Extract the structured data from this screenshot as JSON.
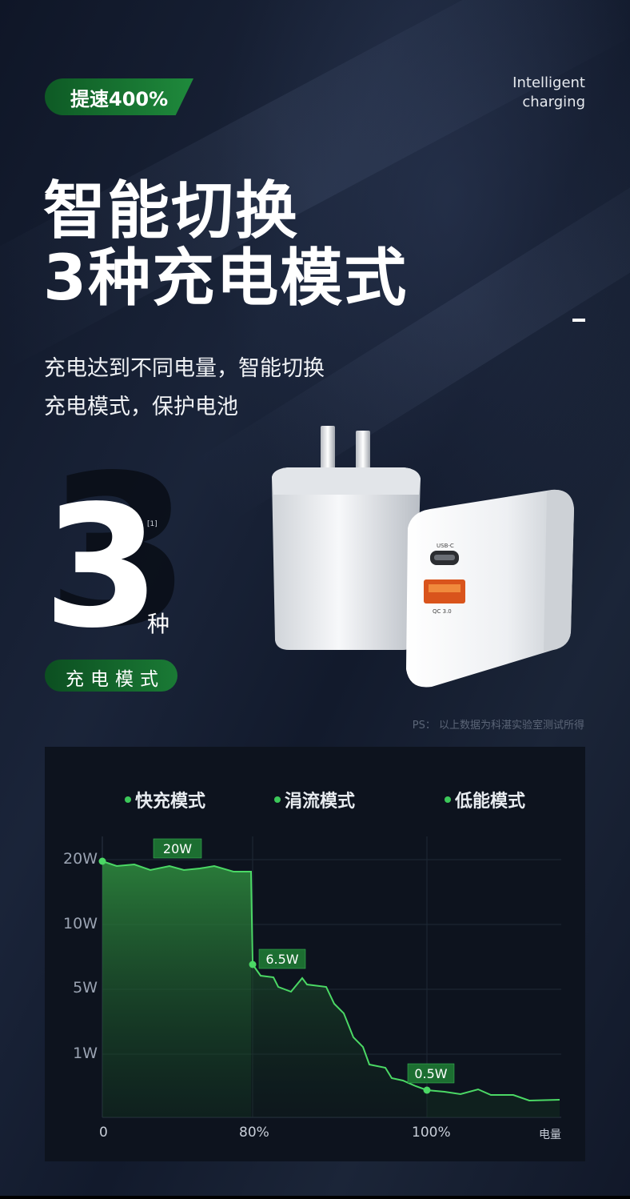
{
  "header": {
    "badge": "提速400%",
    "intelligent_line1": "Intelligent",
    "intelligent_line2": "charging"
  },
  "headline": {
    "line1": "智能切换",
    "line2": "3种充电模式"
  },
  "subtitle": {
    "line1": "充电达到不同电量，智能切换",
    "line2": "充电模式，保护电池"
  },
  "stat": {
    "number": "3",
    "footnote": "[1]",
    "unit": "种",
    "label": "充电模式"
  },
  "product": {
    "port_c_label": "USB-C",
    "port_a_label": "QC 3.0"
  },
  "ps_note": "PS：  以上数据为科湛实验室测试所得",
  "colors": {
    "accent_green": "#1f8a3c",
    "line_green": "#3cc85a",
    "background": "#131b2c"
  },
  "chart_data": {
    "type": "area",
    "legend": [
      "快充模式",
      "涓流模式",
      "低能模式"
    ],
    "y_ticks": [
      "20W",
      "10W",
      "5W",
      "1W"
    ],
    "x_ticks": [
      "0",
      "80%",
      "100%"
    ],
    "x_unit_label": "电量",
    "annotations": [
      {
        "label": "20W",
        "x": 0,
        "y": 20
      },
      {
        "label": "6.5W",
        "x": 80,
        "y": 6.5
      },
      {
        "label": "0.5W",
        "x": 100,
        "y": 0.5
      }
    ]
  }
}
